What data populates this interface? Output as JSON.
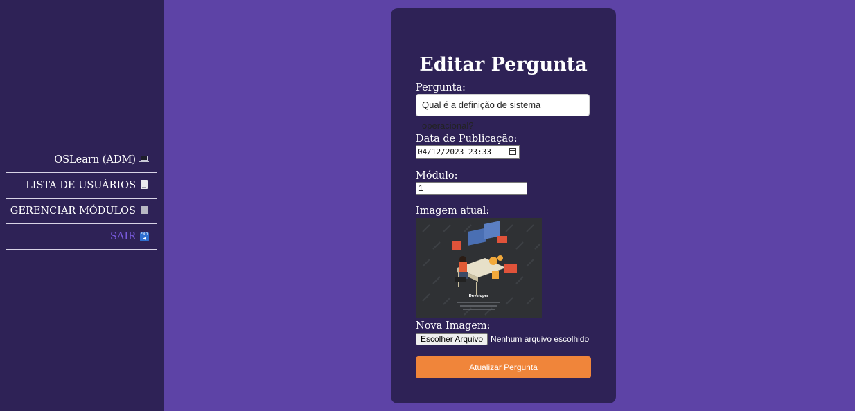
{
  "sidebar": {
    "items": [
      {
        "label": "OSLearn (ADM)",
        "icon": "laptop-icon"
      },
      {
        "label": "LISTA DE USUÁRIOS",
        "icon": "page-icon"
      },
      {
        "label": "GERENCIAR MÓDULOS",
        "icon": "file-cabinet-icon"
      },
      {
        "label": "SAIR",
        "icon": "end-arrow-icon"
      }
    ]
  },
  "form": {
    "title": "Editar Pergunta",
    "question_label": "Pergunta:",
    "question_value": "Qual é a definição de sistema operacional?",
    "date_label": "Data de Publicação:",
    "date_value": "04/12/2023 23:33",
    "module_label": "Módulo:",
    "module_value": "1",
    "current_image_label": "Imagem atual:",
    "current_image_caption": "Developer",
    "new_image_label": "Nova Imagem:",
    "file_button": "Escolher Arquivo",
    "file_status": "Nenhum arquivo escolhido",
    "submit_label": "Atualizar Pergunta"
  },
  "colors": {
    "background": "#5d43a6",
    "sidebar": "#2e2256",
    "card": "#2e2256",
    "accent": "#f0853a",
    "logout_link": "#7b5ce0"
  }
}
